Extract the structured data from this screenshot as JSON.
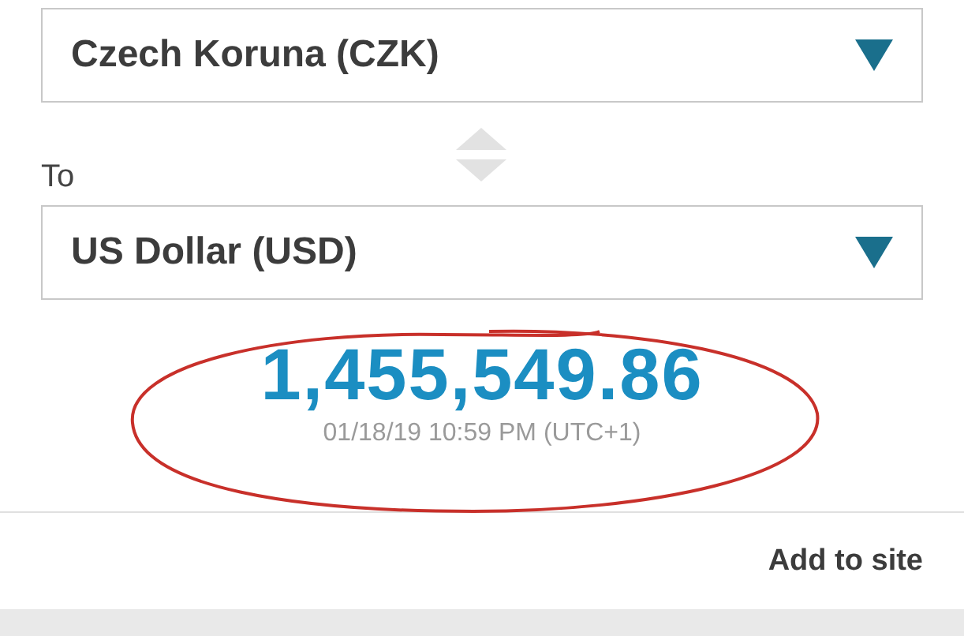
{
  "from_select": {
    "value": "Czech Koruna (CZK)"
  },
  "to_label": "To",
  "to_select": {
    "value": "US Dollar (USD)"
  },
  "result": {
    "amount": "1,455,549.86",
    "timestamp": "01/18/19 10:59 PM (UTC+1)"
  },
  "footer": {
    "link": "Add to site"
  }
}
